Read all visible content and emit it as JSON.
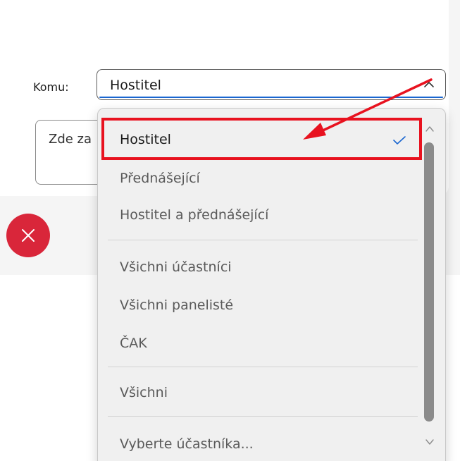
{
  "recipient": {
    "label": "Komu:",
    "selected_value": "Hostitel"
  },
  "message": {
    "placeholder": "Zde za"
  },
  "dropdown": {
    "items": [
      {
        "label": "Hostitel",
        "selected": true
      },
      {
        "label": "Přednášející",
        "selected": false
      },
      {
        "label": "Hostitel a přednášející",
        "selected": false
      },
      {
        "label": "Všichni účastníci",
        "selected": false
      },
      {
        "label": "Všichni panelisté",
        "selected": false
      },
      {
        "label": "ČAK",
        "selected": false
      },
      {
        "label": "Všichni",
        "selected": false
      },
      {
        "label": "Vyberte účastníka...",
        "selected": false
      }
    ]
  },
  "icons": {
    "close": "close-icon",
    "chevron": "chevron-up-icon",
    "check": "check-icon"
  },
  "colors": {
    "accent": "#1a66d0",
    "close_button": "#d9263a",
    "annotation": "#e8121f"
  }
}
